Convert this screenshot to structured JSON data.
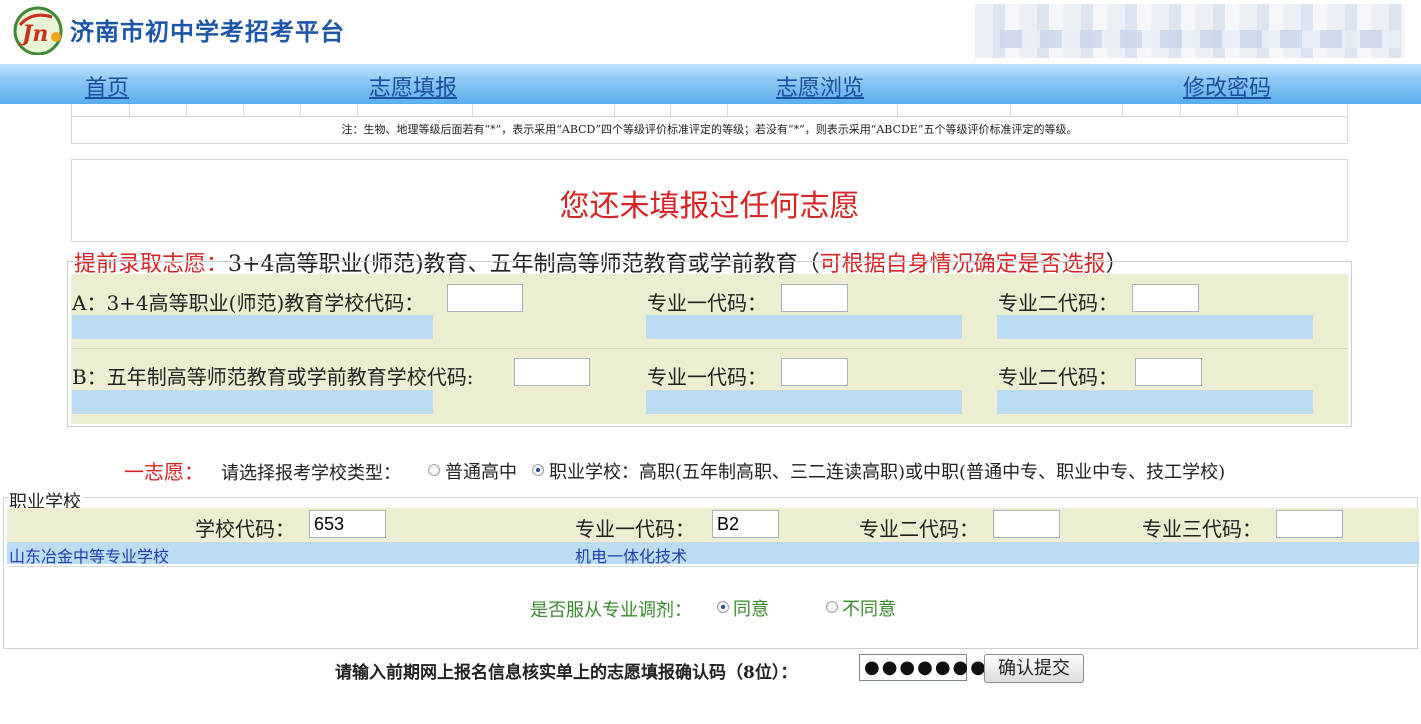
{
  "header": {
    "site_title": "济南市初中学考招考平台",
    "logo_icon": "jinan-exam-logo"
  },
  "nav": {
    "items": [
      {
        "label": "首页"
      },
      {
        "label": "志愿填报"
      },
      {
        "label": "志愿浏览"
      },
      {
        "label": "修改密码"
      }
    ]
  },
  "grades_note": "注：生物、地理等级后面若有“*”，表示采用“ABCD”四个等级评价标准评定的等级；若没有“*”，则表示采用“ABCDE”五个等级评价标准评定的等级。",
  "notice": "您还未填报过任何志愿",
  "early": {
    "heading_prefix": "提前录取志愿：",
    "heading_main": "3+4高等职业(师范)教育、五年制高等师范教育或学前教育（",
    "heading_hint": "可根据自身情况确定是否选报",
    "heading_suffix": "）",
    "rows": [
      {
        "school_label": "A：3+4高等职业(师范)教育学校代码：",
        "school_value": "",
        "major1_label": "专业一代码：",
        "major1_value": "",
        "major2_label": "专业二代码：",
        "major2_value": ""
      },
      {
        "school_label": "B：五年制高等师范教育或学前教育学校代码:",
        "school_value": "",
        "major1_label": "专业一代码：",
        "major1_value": "",
        "major2_label": "专业二代码：",
        "major2_value": ""
      }
    ]
  },
  "first_choice": {
    "heading": "一志愿：",
    "type_prompt": "请选择报考学校类型：",
    "options": [
      {
        "label": "普通高中",
        "selected": false
      },
      {
        "label": "职业学校：高职(五年制高职、三二连读高职)或中职(普通中专、职业中专、技工学校)",
        "selected": true
      }
    ]
  },
  "vocational": {
    "legend": "职业学校",
    "school_code_label": "学校代码：",
    "school_code_value": "653",
    "major1_label": "专业一代码：",
    "major1_value": "B2",
    "major2_label": "专业二代码：",
    "major2_value": "",
    "major3_label": "专业三代码：",
    "major3_value": "",
    "school_name": "山东冶金中等专业学校",
    "major1_name": "机电一体化技术",
    "adjust_prompt": "是否服从专业调剂：",
    "adjust_options": [
      {
        "label": "同意",
        "selected": true
      },
      {
        "label": "不同意",
        "selected": false
      }
    ]
  },
  "confirm": {
    "prompt": "请输入前期网上报名信息核实单上的志愿填报确认码（8位）：",
    "code_masked": "●●●●●●●●",
    "submit_label": "确认提交"
  },
  "colors": {
    "nav_gradient_bottom": "#5aaeed",
    "title_blue": "#1d56a8",
    "alert_red": "#d62525",
    "form_bg": "#ededd2",
    "result_blue": "#bcdcf2",
    "adjust_green": "#3a8a2e"
  }
}
